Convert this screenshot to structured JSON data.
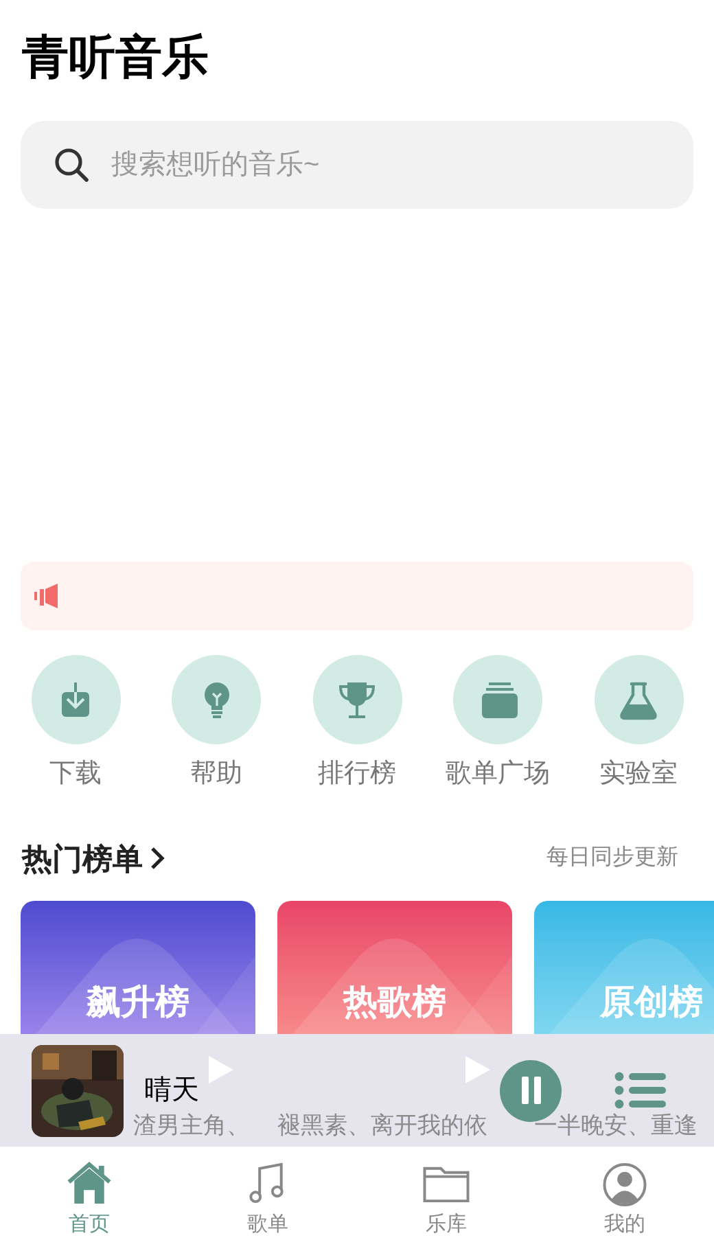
{
  "app_title": "青听音乐",
  "search": {
    "placeholder": "搜索想听的音乐~"
  },
  "shortcuts": [
    {
      "label": "下载"
    },
    {
      "label": "帮助"
    },
    {
      "label": "排行榜"
    },
    {
      "label": "歌单广场"
    },
    {
      "label": "实验室"
    }
  ],
  "hot_charts": {
    "title": "热门榜单",
    "subtitle": "每日同步更新",
    "cards": [
      {
        "title": "飙升榜",
        "description": "渣男主角、"
      },
      {
        "title": "热歌榜",
        "description": "褪黑素、离开我的依"
      },
      {
        "title": "原创榜",
        "description": "一半晚安、重逢"
      }
    ]
  },
  "player": {
    "song": "晴天",
    "playing": true
  },
  "nav_tabs": [
    {
      "label": "首页",
      "selected": true
    },
    {
      "label": "歌单",
      "selected": false
    },
    {
      "label": "乐库",
      "selected": false
    },
    {
      "label": "我的",
      "selected": false
    }
  ]
}
